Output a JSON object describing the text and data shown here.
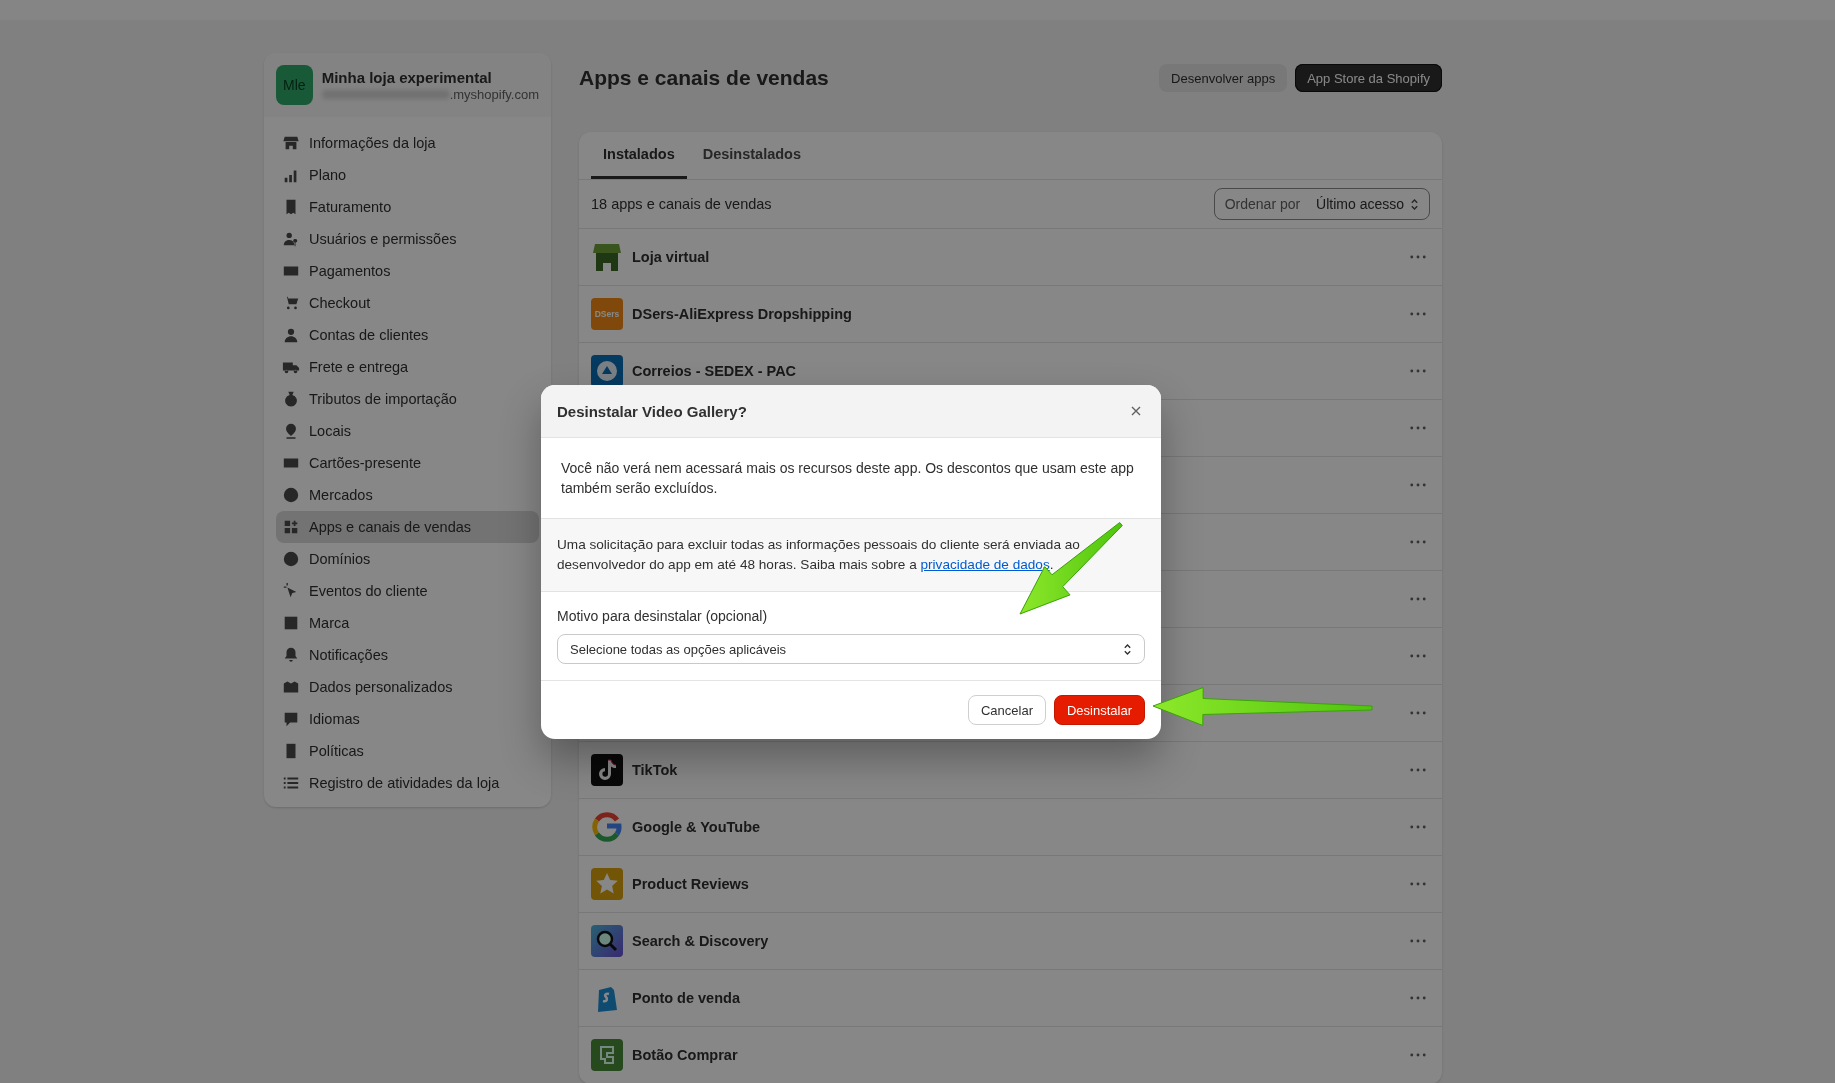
{
  "store": {
    "avatar": "Mle",
    "name": "Minha loja experimental",
    "domain_suffix": ".myshopify.com"
  },
  "sidebar": {
    "items": [
      {
        "label": "Informações da loja",
        "selected": false
      },
      {
        "label": "Plano",
        "selected": false
      },
      {
        "label": "Faturamento",
        "selected": false
      },
      {
        "label": "Usuários e permissões",
        "selected": false
      },
      {
        "label": "Pagamentos",
        "selected": false
      },
      {
        "label": "Checkout",
        "selected": false
      },
      {
        "label": "Contas de clientes",
        "selected": false
      },
      {
        "label": "Frete e entrega",
        "selected": false
      },
      {
        "label": "Tributos de importação",
        "selected": false
      },
      {
        "label": "Locais",
        "selected": false
      },
      {
        "label": "Cartões-presente",
        "selected": false
      },
      {
        "label": "Mercados",
        "selected": false
      },
      {
        "label": "Apps e canais de vendas",
        "selected": true
      },
      {
        "label": "Domínios",
        "selected": false
      },
      {
        "label": "Eventos do cliente",
        "selected": false
      },
      {
        "label": "Marca",
        "selected": false
      },
      {
        "label": "Notificações",
        "selected": false
      },
      {
        "label": "Dados personalizados",
        "selected": false
      },
      {
        "label": "Idiomas",
        "selected": false
      },
      {
        "label": "Políticas",
        "selected": false
      },
      {
        "label": "Registro de atividades da loja",
        "selected": false
      }
    ]
  },
  "page": {
    "title": "Apps e canais de vendas",
    "buttons": [
      {
        "label": "Desenvolver apps",
        "kind": "secondary"
      },
      {
        "label": "App Store da Shopify",
        "kind": "primary"
      }
    ]
  },
  "tabs": [
    {
      "label": "Instalados",
      "selected": true
    },
    {
      "label": "Desinstalados",
      "selected": false
    }
  ],
  "list": {
    "count": "18 apps e canais de vendas",
    "sort": {
      "label": "Ordenar por",
      "value": "Último acesso"
    },
    "rows": [
      {
        "kind": "app",
        "name": "Loja virtual"
      },
      {
        "kind": "app",
        "name": "DSers-AliExpress Dropshipping",
        "logo_text": "DSers"
      },
      {
        "kind": "app",
        "name": "Correios - SEDEX - PAC"
      },
      {
        "kind": "covered"
      },
      {
        "kind": "covered"
      },
      {
        "kind": "covered"
      },
      {
        "kind": "covered"
      },
      {
        "kind": "covered"
      },
      {
        "kind": "covered"
      },
      {
        "kind": "app",
        "name": "TikTok"
      },
      {
        "kind": "app",
        "name": "Google & YouTube"
      },
      {
        "kind": "app",
        "name": "Product Reviews"
      },
      {
        "kind": "app",
        "name": "Search & Discovery"
      },
      {
        "kind": "app",
        "name": "Ponto de venda"
      },
      {
        "kind": "app",
        "name": "Botão Comprar"
      }
    ]
  },
  "modal": {
    "title": "Desinstalar Video Gallery?",
    "message": "Você não verá nem acessará mais os recursos deste app. Os descontos que usam este app também serão excluídos.",
    "privacy_note": {
      "text": "Uma solicitação para excluir todas as informações pessoais do cliente será enviada ao desenvolvedor do app em até 48 horas. Saiba mais sobre a",
      "link": "privacidade de dados",
      "after": "."
    },
    "reason": {
      "label": "Motivo para desinstalar (opcional)",
      "placeholder": "Selecione todas as opções aplicáveis"
    },
    "buttons": [
      {
        "label": "Cancelar",
        "kind": "secondary"
      },
      {
        "label": "Desinstalar",
        "kind": "critical"
      }
    ]
  }
}
